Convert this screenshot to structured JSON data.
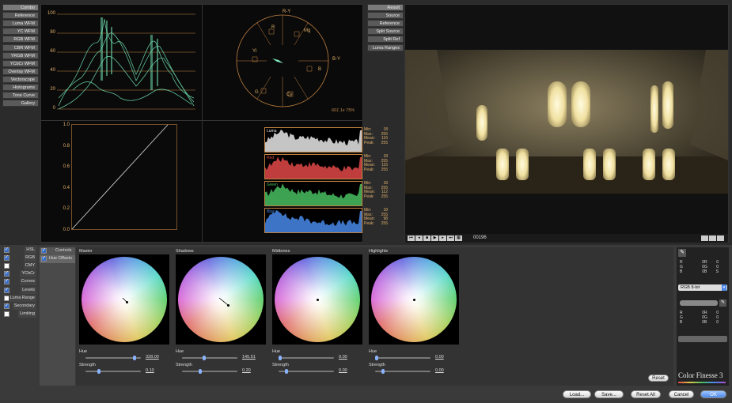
{
  "nav_left": [
    "Combo",
    "Reference",
    "Luma WFM",
    "YC WFM",
    "RGB WFM",
    "CBR WFM",
    "YRGB WFM",
    "YCbCr WFM",
    "Overlay WFM",
    "Vectorscope",
    "Histograms",
    "Tone Curve",
    "Gallery"
  ],
  "nav_right": [
    "Result",
    "Source",
    "Reference",
    "Split Source",
    "Split Ref",
    "Luma Ranges"
  ],
  "waveform": {
    "ticks": [
      "100",
      "80",
      "60",
      "40",
      "20",
      "0"
    ]
  },
  "vectorscope": {
    "labels": {
      "ry": "R-Y",
      "r": "R",
      "mg": "Mg",
      "yl": "Yl",
      "by": "B-Y",
      "b": "B",
      "g": "G",
      "cy": "Cy"
    },
    "caption": "601 1x 75%"
  },
  "tonecurve": {
    "ticks": [
      "1.0",
      "0.8",
      "0.6",
      "0.4",
      "0.2",
      "0.0"
    ]
  },
  "histograms": [
    {
      "name": "Luma",
      "color": "#e8e8e8",
      "min": "18",
      "max": "255",
      "mean": "116",
      "peak": "255"
    },
    {
      "name": "Red",
      "color": "#e04848",
      "min": "18",
      "max": "255",
      "mean": "115",
      "peak": "255"
    },
    {
      "name": "Green",
      "color": "#48c060",
      "min": "18",
      "max": "255",
      "mean": "112",
      "peak": "255"
    },
    {
      "name": "Blue",
      "color": "#4888e8",
      "min": "18",
      "max": "255",
      "mean": "98",
      "peak": "255"
    }
  ],
  "hist_stat_labels": {
    "min": "Min:",
    "max": "Max:",
    "mean": "Mean:",
    "peak": "Peak:"
  },
  "timecode": "00196",
  "left_tools": [
    {
      "label": "HSL",
      "checked": true
    },
    {
      "label": "RGB",
      "checked": true
    },
    {
      "label": "CMY",
      "checked": false
    },
    {
      "label": "YCbCr",
      "checked": true
    },
    {
      "label": "Curves",
      "checked": true
    },
    {
      "label": "Levels",
      "checked": true
    },
    {
      "label": "Luma Range",
      "checked": false
    },
    {
      "label": "Secondary",
      "checked": true
    },
    {
      "label": "Limiting",
      "checked": false
    }
  ],
  "subtabs": [
    "Controls",
    "Hue Offsets"
  ],
  "wheels": [
    {
      "title": "Master",
      "hue_label": "Hue",
      "hue": "328.00",
      "hue_frac": 0.91,
      "strength_label": "Strength",
      "strength": "0.10",
      "str_frac": 0.1,
      "dot_dx": 3,
      "dot_dy": 3
    },
    {
      "title": "Shadows",
      "hue_label": "Hue",
      "hue": "145.51",
      "hue_frac": 0.4,
      "strength_label": "Strength",
      "strength": "0.20",
      "str_frac": 0.2,
      "dot_dx": 9,
      "dot_dy": 7
    },
    {
      "title": "Midtones",
      "hue_label": "Hue",
      "hue": "0.00",
      "hue_frac": 0.0,
      "strength_label": "Strength",
      "strength": "0.00",
      "str_frac": 0.0,
      "dot_dx": 0,
      "dot_dy": 0
    },
    {
      "title": "Highlights",
      "hue_label": "Hue",
      "hue": "0.00",
      "hue_frac": 0.0,
      "strength_label": "Strength",
      "strength": "0.00",
      "str_frac": 0.0,
      "dot_dx": 0,
      "dot_dy": 0
    }
  ],
  "reset_label": "Reset",
  "side_panel": {
    "rows1": [
      [
        "R",
        "0",
        "R",
        "0"
      ],
      [
        "G",
        "0",
        "G",
        "0"
      ],
      [
        "B",
        "0",
        "B",
        "S"
      ]
    ],
    "select": "RGB 8-bit",
    "rows2": [
      [
        "R",
        "0",
        "R",
        "0"
      ],
      [
        "G",
        "0",
        "G",
        "0"
      ],
      [
        "B",
        "0",
        "B",
        "0"
      ]
    ]
  },
  "brand": "Color Finesse 3",
  "footer": {
    "load": "Load...",
    "save": "Save...",
    "reset_all": "Reset All",
    "cancel": "Cancel",
    "ok": "OK"
  }
}
